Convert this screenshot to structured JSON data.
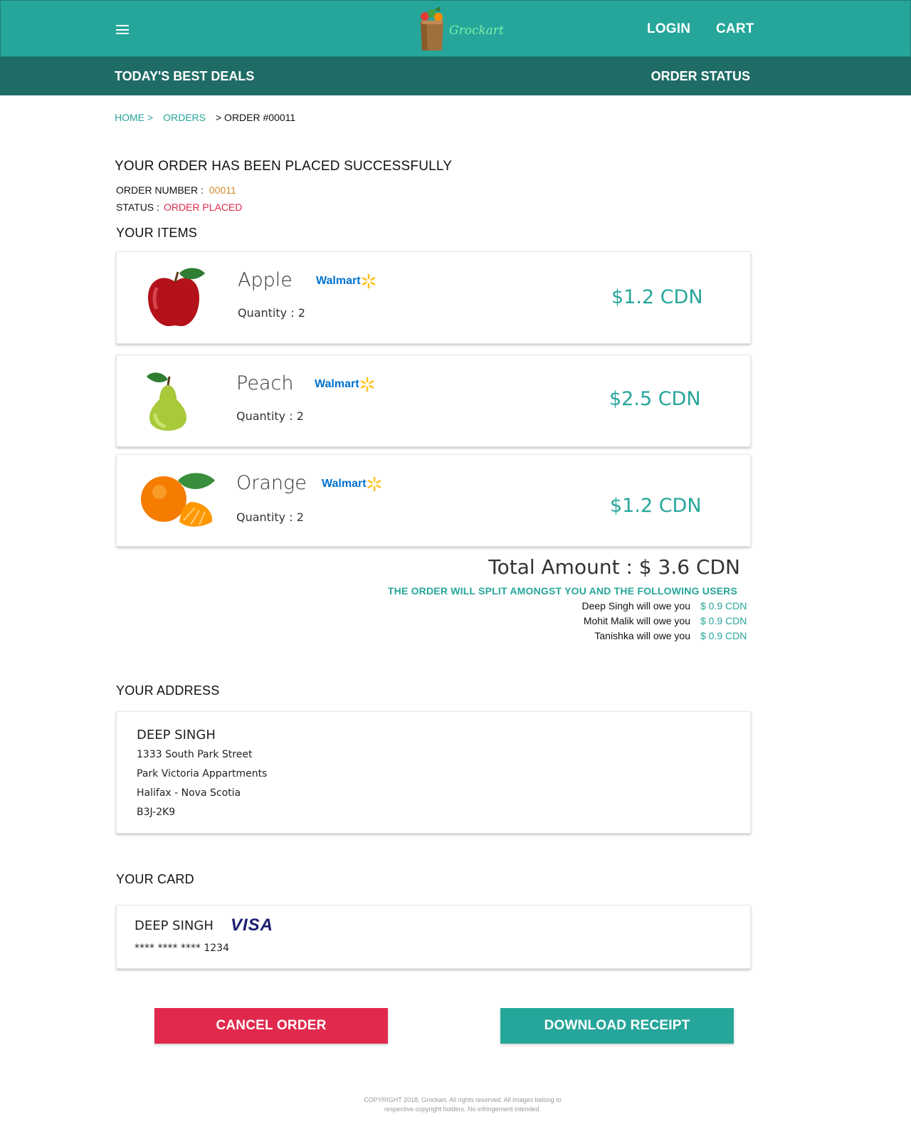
{
  "header": {
    "brand": "Grockart",
    "login_label": "LOGIN",
    "cart_label": "CART",
    "menu_icon": "hamburger-menu-icon"
  },
  "subnav": {
    "deals_label": "TODAY'S BEST DEALS",
    "status_label": "ORDER STATUS"
  },
  "breadcrumb": {
    "home": "HOME >",
    "orders": "ORDERS",
    "current": "> ORDER #00011"
  },
  "order": {
    "title": "YOUR ORDER HAS BEEN PLACED SUCCESSFULLY",
    "number_label": "ORDER NUMBER :",
    "number_value": "00011",
    "status_label": "STATUS :",
    "status_value": "ORDER PLACED"
  },
  "items_section": {
    "title": "YOUR ITEMS",
    "items": [
      {
        "name": "Apple",
        "quantity": "Quantity : 2",
        "store": "Walmart",
        "price": "$1.2 CDN",
        "image": "apple-image"
      },
      {
        "name": "Peach",
        "quantity": "Quantity : 2",
        "store": "Walmart",
        "price": "$2.5 CDN",
        "image": "pear-image"
      },
      {
        "name": "Orange",
        "quantity": "Quantity : 2",
        "store": "Walmart",
        "price": "$1.2 CDN",
        "image": "orange-image"
      }
    ]
  },
  "totals": {
    "total": "Total Amount : $ 3.6 CDN",
    "split_note": "THE ORDER WILL SPLIT AMONGST YOU AND THE FOLLOWING  USERS",
    "split": [
      {
        "text": "Deep Singh will owe you",
        "amount": "$ 0.9 CDN"
      },
      {
        "text": "Mohit Malik will owe you",
        "amount": "$ 0.9 CDN"
      },
      {
        "text": "Tanishka will owe you",
        "amount": "$ 0.9 CDN"
      }
    ]
  },
  "address": {
    "title": "YOUR ADDRESS",
    "name": "DEEP SINGH",
    "line1": "1333 South Park Street",
    "line2": "Park Victoria Appartments",
    "line3": "Halifax - Nova Scotia",
    "line4": "B3J-2K9"
  },
  "payment": {
    "title": "YOUR CARD",
    "holder": "DEEP SINGH",
    "brand": "VISA",
    "number": "**** **** **** 1234"
  },
  "actions": {
    "cancel_label": "CANCEL ORDER",
    "download_label": "DOWNLOAD RECEIPT"
  },
  "footer": {
    "line1": "COPYRIGHT 2018, Grockart. All rights reserved. All images belong to",
    "line2": "respective copyright holders. No infringement intended."
  },
  "colors": {
    "primary": "#26a69a",
    "primary_dark": "#1f6b65",
    "danger": "#e0294c",
    "order_number": "#d18a2c",
    "walmart_blue": "#0071ce",
    "walmart_yellow": "#ffc220"
  }
}
